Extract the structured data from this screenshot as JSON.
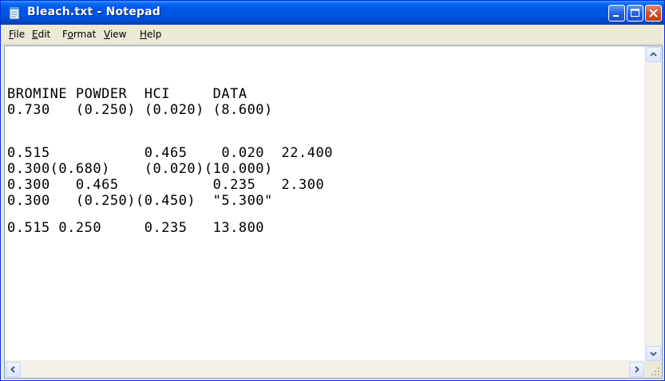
{
  "window": {
    "title": "Bleach.txt - Notepad",
    "icon": "notepad-icon",
    "controls": {
      "minimize": "minimize-icon",
      "maximize": "maximize-icon",
      "close": "close-icon"
    }
  },
  "menu": {
    "file": {
      "access_key": "F",
      "rest": "ile"
    },
    "edit": {
      "access_key": "E",
      "rest": "dit"
    },
    "format": {
      "pre": "F",
      "access_key": "o",
      "rest": "rmat"
    },
    "view": {
      "access_key": "V",
      "rest": "iew"
    },
    "help": {
      "access_key": "H",
      "rest": "elp"
    }
  },
  "document": {
    "lines": [
      "BROMINE POWDER  HCI     DATA",
      "0.730   (0.250) (0.020) (8.600)",
      "",
      "0.515           0.465    0.020  22.400",
      "0.300(0.680)    (0.020)(10.000)",
      "0.300   0.465           0.235   2.300",
      "0.300   (0.250)(0.450)  \"5.300\"",
      "",
      "0.515 0.250     0.235   13.800"
    ]
  },
  "scrollbars": {
    "up_icon": "arrow-up-icon",
    "down_icon": "arrow-down-icon",
    "left_icon": "arrow-left-icon",
    "right_icon": "arrow-right-icon",
    "grip_icon": "resize-grip-icon"
  },
  "colors": {
    "titlebar": "#0055e5",
    "close_button": "#d4502a",
    "chrome": "#ece9d8",
    "editor_bg": "#ffffff",
    "text": "#000000"
  }
}
